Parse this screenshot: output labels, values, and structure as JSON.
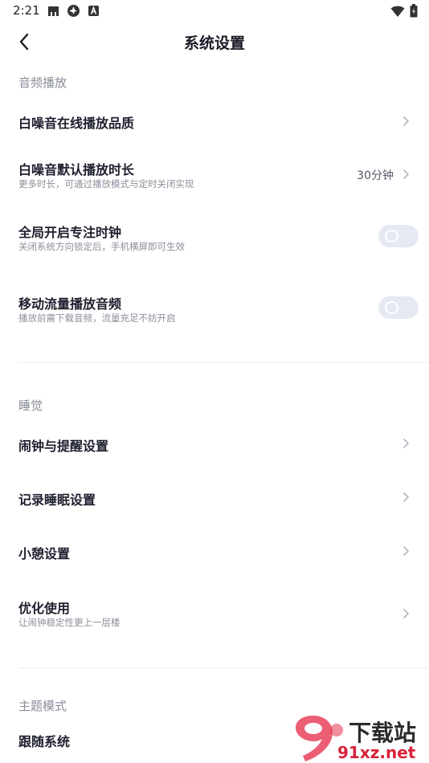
{
  "status_bar": {
    "time": "2:21"
  },
  "header": {
    "title": "系统设置"
  },
  "sections": {
    "audio": {
      "title": "音频播放",
      "items": [
        {
          "title": "白噪音在线播放品质"
        },
        {
          "title": "白噪音默认播放时长",
          "subtitle": "更多时长，可通过播放模式与定时关闭实现",
          "value": "30分钟"
        },
        {
          "title": "全局开启专注时钟",
          "subtitle": "关闭系统方向锁定后，手机横屏即可生效",
          "toggle_on": false
        },
        {
          "title": "移动流量播放音频",
          "subtitle": "播放前需下载音频，流量充足不妨开启",
          "toggle_on": false
        }
      ]
    },
    "sleep": {
      "title": "睡觉",
      "items": [
        {
          "title": "闹钟与提醒设置"
        },
        {
          "title": "记录睡眠设置"
        },
        {
          "title": "小憩设置"
        },
        {
          "title": "优化使用",
          "subtitle": "让闹钟稳定性更上一层楼"
        }
      ]
    },
    "theme": {
      "title": "主题模式",
      "items": [
        {
          "title": "跟随系统"
        }
      ]
    }
  },
  "watermark": {
    "main": "下载站",
    "sub": "91xz.net"
  },
  "icons": {
    "back": "chevron-left-icon",
    "row_arrow": "chevron-right-icon"
  },
  "colors": {
    "toggle_off": "#e6e8f2",
    "section_title": "#8a8d9a",
    "watermark_red": "#d8223a"
  }
}
